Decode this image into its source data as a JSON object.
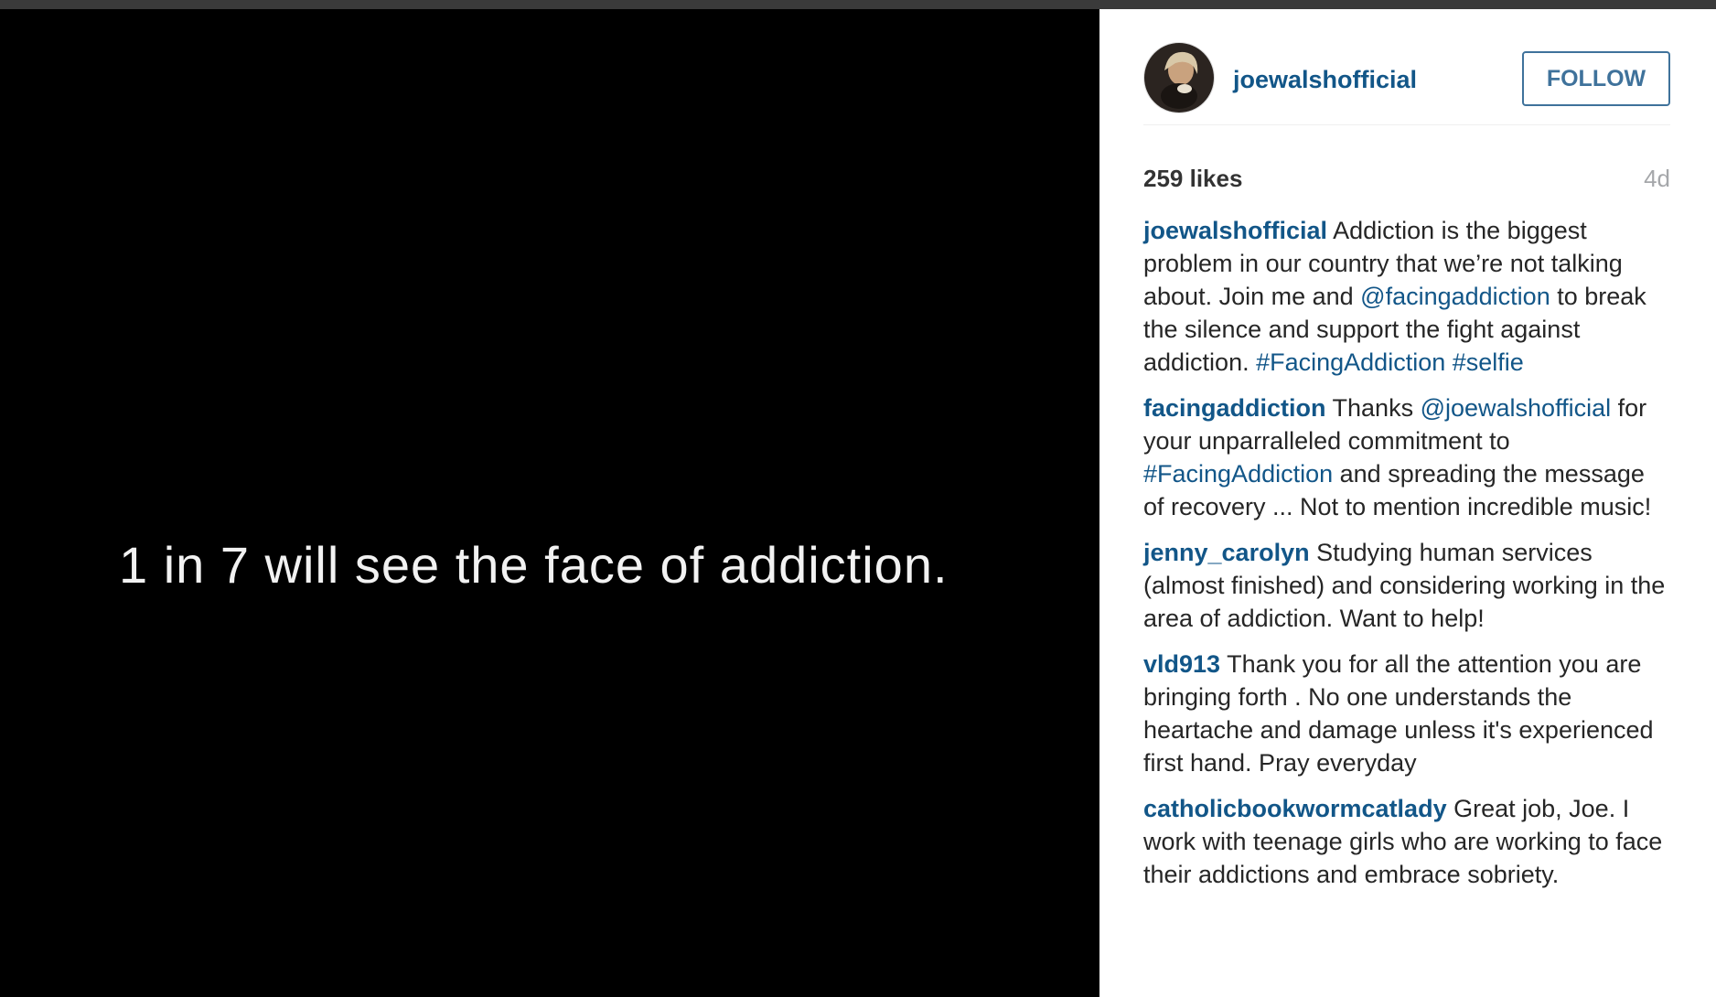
{
  "media": {
    "caption": "1 in 7 will see the face of addiction."
  },
  "header": {
    "username": "joewalshofficial",
    "follow_label": "FOLLOW"
  },
  "stats": {
    "likes": "259 likes",
    "age": "4d"
  },
  "comments": [
    {
      "user": "joewalshofficial",
      "parts": [
        {
          "t": " Addiction is the biggest problem in our country that we’re not talking about. Join me and "
        },
        {
          "t": "@facingaddiction",
          "link": true
        },
        {
          "t": " to break the silence and support the fight against addiction. "
        },
        {
          "t": "#FacingAddiction",
          "link": true
        },
        {
          "t": " "
        },
        {
          "t": "#selfie",
          "link": true
        }
      ]
    },
    {
      "user": "facingaddiction",
      "parts": [
        {
          "t": " Thanks "
        },
        {
          "t": "@joewalshofficial",
          "link": true
        },
        {
          "t": " for your unparralleled commitment to "
        },
        {
          "t": "#FacingAddiction",
          "link": true
        },
        {
          "t": " and spreading the message of recovery ... Not to mention incredible music!"
        }
      ]
    },
    {
      "user": "jenny_carolyn",
      "parts": [
        {
          "t": " Studying human services (almost finished) and considering working in the area of addiction. Want to help!"
        }
      ]
    },
    {
      "user": "vld913",
      "parts": [
        {
          "t": " Thank you for all the attention you are bringing forth . No one understands the heartache and damage unless it's experienced first hand. Pray everyday"
        }
      ]
    },
    {
      "user": "catholicbookwormcatlady",
      "parts": [
        {
          "t": " Great job, Joe. I work with teenage girls who are working to face their addictions and embrace sobriety."
        }
      ]
    }
  ]
}
